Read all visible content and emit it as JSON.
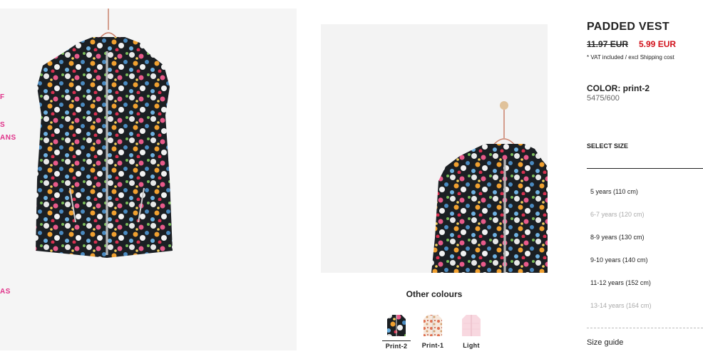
{
  "left_nav": {
    "items": [
      {
        "label": "F"
      },
      {
        "label": "S"
      },
      {
        "label": "ANS"
      },
      {
        "label": "AS"
      }
    ]
  },
  "product": {
    "title": "PADDED VEST",
    "price_old": "11.97 EUR",
    "price_new": "5.99 EUR",
    "vat_note": "* VAT included / excl Shipping cost",
    "color_label": "COLOR: print-2",
    "reference": "5475/600"
  },
  "sizes": {
    "heading": "SELECT SIZE",
    "options": [
      {
        "label": "5 years (110 cm)",
        "available": true
      },
      {
        "label": "6-7 years (120 cm)",
        "available": false
      },
      {
        "label": "8-9 years (130 cm)",
        "available": true
      },
      {
        "label": "9-10 years (140 cm)",
        "available": true
      },
      {
        "label": "11-12 years (152 cm)",
        "available": true
      },
      {
        "label": "13-14 years (164 cm)",
        "available": false
      }
    ],
    "guide_label": "Size guide"
  },
  "other_colours": {
    "title": "Other colours",
    "swatches": [
      {
        "label": "Print-2",
        "selected": true
      },
      {
        "label": "Print-1",
        "selected": false
      },
      {
        "label": "Light",
        "selected": false
      }
    ]
  },
  "colors": {
    "sale_red": "#d1101a",
    "nav_pink": "#e0338a"
  }
}
